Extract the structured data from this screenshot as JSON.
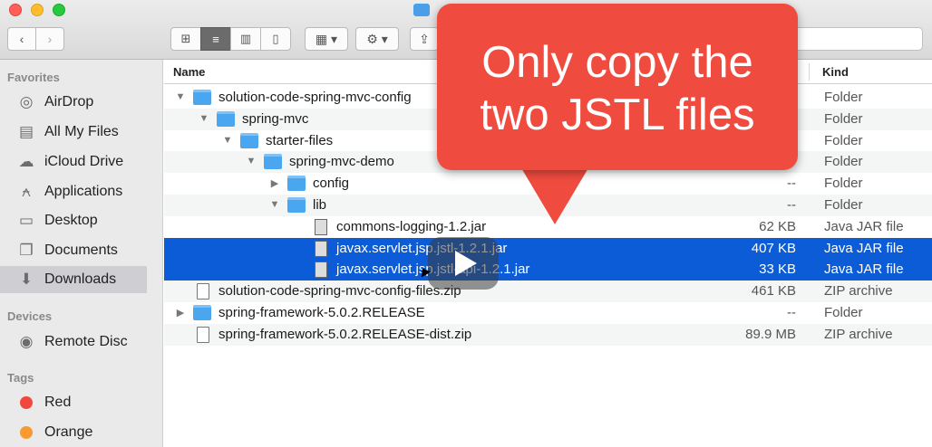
{
  "window": {
    "title_icon": "folder-icon"
  },
  "toolbar": {
    "back_glyph": "‹",
    "forward_glyph": "›",
    "view_modes": [
      {
        "name": "icon-view",
        "glyph": "⊞"
      },
      {
        "name": "list-view",
        "glyph": "≡"
      },
      {
        "name": "column-view",
        "glyph": "▥"
      },
      {
        "name": "cover-flow-view",
        "glyph": "▯"
      }
    ],
    "arrange_glyph": "▦ ▾",
    "action_glyph": "⚙ ▾",
    "share_glyph": "⇪"
  },
  "sidebar": {
    "favorites_label": "Favorites",
    "favorites": [
      {
        "label": "AirDrop",
        "icon": "airdrop-icon",
        "glyph": "◎"
      },
      {
        "label": "All My Files",
        "icon": "all-files-icon",
        "glyph": "▤"
      },
      {
        "label": "iCloud Drive",
        "icon": "cloud-icon",
        "glyph": "☁"
      },
      {
        "label": "Applications",
        "icon": "applications-icon",
        "glyph": "⍲"
      },
      {
        "label": "Desktop",
        "icon": "desktop-icon",
        "glyph": "▭"
      },
      {
        "label": "Documents",
        "icon": "documents-icon",
        "glyph": "❐"
      },
      {
        "label": "Downloads",
        "icon": "downloads-icon",
        "glyph": "⬇"
      }
    ],
    "devices_label": "Devices",
    "devices": [
      {
        "label": "Remote Disc",
        "icon": "disc-icon",
        "glyph": "◉"
      }
    ],
    "tags_label": "Tags",
    "tags": [
      {
        "label": "Red",
        "color": "#f2473f"
      },
      {
        "label": "Orange",
        "color": "#f79a32"
      }
    ]
  },
  "list": {
    "columns": {
      "name": "Name",
      "kind": "Kind"
    },
    "rows": [
      {
        "name": "solution-code-spring-mvc-config",
        "size": "",
        "kind": "Folder",
        "level": 0,
        "expanded": true,
        "type": "folder"
      },
      {
        "name": "spring-mvc",
        "size": "",
        "kind": "Folder",
        "level": 1,
        "expanded": true,
        "type": "folder"
      },
      {
        "name": "starter-files",
        "size": "",
        "kind": "Folder",
        "level": 2,
        "expanded": true,
        "type": "folder"
      },
      {
        "name": "spring-mvc-demo",
        "size": "",
        "kind": "Folder",
        "level": 3,
        "expanded": true,
        "type": "folder"
      },
      {
        "name": "config",
        "size": "--",
        "kind": "Folder",
        "level": 4,
        "expanded": false,
        "type": "folder"
      },
      {
        "name": "lib",
        "size": "--",
        "kind": "Folder",
        "level": 4,
        "expanded": true,
        "type": "folder"
      },
      {
        "name": "commons-logging-1.2.jar",
        "size": "62 KB",
        "kind": "Java JAR file",
        "level": 5,
        "type": "jar"
      },
      {
        "name": "javax.servlet.jsp.jstl-1.2.1.jar",
        "size": "407 KB",
        "kind": "Java JAR file",
        "level": 5,
        "type": "jar",
        "selected": true
      },
      {
        "name": "javax.servlet.jsp.jstl-api-1.2.1.jar",
        "size": "33 KB",
        "kind": "Java JAR file",
        "level": 5,
        "type": "jar",
        "selected": true
      },
      {
        "name": "solution-code-spring-mvc-config-files.zip",
        "size": "461 KB",
        "kind": "ZIP archive",
        "level": 0,
        "type": "zip"
      },
      {
        "name": "spring-framework-5.0.2.RELEASE",
        "size": "--",
        "kind": "Folder",
        "level": 0,
        "expanded": false,
        "type": "folder"
      },
      {
        "name": "spring-framework-5.0.2.RELEASE-dist.zip",
        "size": "89.9 MB",
        "kind": "ZIP archive",
        "level": 0,
        "type": "zip"
      }
    ]
  },
  "callout": {
    "line1": "Only copy the",
    "line2": "two JSTL files",
    "color": "#f04b3f"
  },
  "colors": {
    "selection": "#0b5cd6"
  }
}
